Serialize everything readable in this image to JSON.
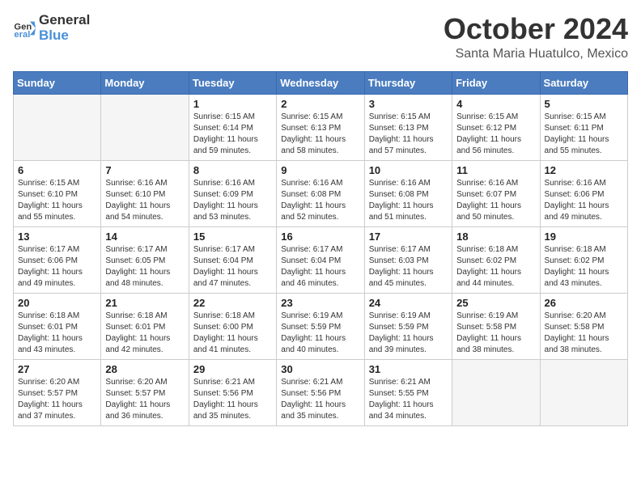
{
  "header": {
    "logo_general": "General",
    "logo_blue": "Blue",
    "month": "October 2024",
    "location": "Santa Maria Huatulco, Mexico"
  },
  "days_of_week": [
    "Sunday",
    "Monday",
    "Tuesday",
    "Wednesday",
    "Thursday",
    "Friday",
    "Saturday"
  ],
  "weeks": [
    [
      {
        "day": "",
        "info": ""
      },
      {
        "day": "",
        "info": ""
      },
      {
        "day": "1",
        "info": "Sunrise: 6:15 AM\nSunset: 6:14 PM\nDaylight: 11 hours and 59 minutes."
      },
      {
        "day": "2",
        "info": "Sunrise: 6:15 AM\nSunset: 6:13 PM\nDaylight: 11 hours and 58 minutes."
      },
      {
        "day": "3",
        "info": "Sunrise: 6:15 AM\nSunset: 6:13 PM\nDaylight: 11 hours and 57 minutes."
      },
      {
        "day": "4",
        "info": "Sunrise: 6:15 AM\nSunset: 6:12 PM\nDaylight: 11 hours and 56 minutes."
      },
      {
        "day": "5",
        "info": "Sunrise: 6:15 AM\nSunset: 6:11 PM\nDaylight: 11 hours and 55 minutes."
      }
    ],
    [
      {
        "day": "6",
        "info": "Sunrise: 6:15 AM\nSunset: 6:10 PM\nDaylight: 11 hours and 55 minutes."
      },
      {
        "day": "7",
        "info": "Sunrise: 6:16 AM\nSunset: 6:10 PM\nDaylight: 11 hours and 54 minutes."
      },
      {
        "day": "8",
        "info": "Sunrise: 6:16 AM\nSunset: 6:09 PM\nDaylight: 11 hours and 53 minutes."
      },
      {
        "day": "9",
        "info": "Sunrise: 6:16 AM\nSunset: 6:08 PM\nDaylight: 11 hours and 52 minutes."
      },
      {
        "day": "10",
        "info": "Sunrise: 6:16 AM\nSunset: 6:08 PM\nDaylight: 11 hours and 51 minutes."
      },
      {
        "day": "11",
        "info": "Sunrise: 6:16 AM\nSunset: 6:07 PM\nDaylight: 11 hours and 50 minutes."
      },
      {
        "day": "12",
        "info": "Sunrise: 6:16 AM\nSunset: 6:06 PM\nDaylight: 11 hours and 49 minutes."
      }
    ],
    [
      {
        "day": "13",
        "info": "Sunrise: 6:17 AM\nSunset: 6:06 PM\nDaylight: 11 hours and 49 minutes."
      },
      {
        "day": "14",
        "info": "Sunrise: 6:17 AM\nSunset: 6:05 PM\nDaylight: 11 hours and 48 minutes."
      },
      {
        "day": "15",
        "info": "Sunrise: 6:17 AM\nSunset: 6:04 PM\nDaylight: 11 hours and 47 minutes."
      },
      {
        "day": "16",
        "info": "Sunrise: 6:17 AM\nSunset: 6:04 PM\nDaylight: 11 hours and 46 minutes."
      },
      {
        "day": "17",
        "info": "Sunrise: 6:17 AM\nSunset: 6:03 PM\nDaylight: 11 hours and 45 minutes."
      },
      {
        "day": "18",
        "info": "Sunrise: 6:18 AM\nSunset: 6:02 PM\nDaylight: 11 hours and 44 minutes."
      },
      {
        "day": "19",
        "info": "Sunrise: 6:18 AM\nSunset: 6:02 PM\nDaylight: 11 hours and 43 minutes."
      }
    ],
    [
      {
        "day": "20",
        "info": "Sunrise: 6:18 AM\nSunset: 6:01 PM\nDaylight: 11 hours and 43 minutes."
      },
      {
        "day": "21",
        "info": "Sunrise: 6:18 AM\nSunset: 6:01 PM\nDaylight: 11 hours and 42 minutes."
      },
      {
        "day": "22",
        "info": "Sunrise: 6:18 AM\nSunset: 6:00 PM\nDaylight: 11 hours and 41 minutes."
      },
      {
        "day": "23",
        "info": "Sunrise: 6:19 AM\nSunset: 5:59 PM\nDaylight: 11 hours and 40 minutes."
      },
      {
        "day": "24",
        "info": "Sunrise: 6:19 AM\nSunset: 5:59 PM\nDaylight: 11 hours and 39 minutes."
      },
      {
        "day": "25",
        "info": "Sunrise: 6:19 AM\nSunset: 5:58 PM\nDaylight: 11 hours and 38 minutes."
      },
      {
        "day": "26",
        "info": "Sunrise: 6:20 AM\nSunset: 5:58 PM\nDaylight: 11 hours and 38 minutes."
      }
    ],
    [
      {
        "day": "27",
        "info": "Sunrise: 6:20 AM\nSunset: 5:57 PM\nDaylight: 11 hours and 37 minutes."
      },
      {
        "day": "28",
        "info": "Sunrise: 6:20 AM\nSunset: 5:57 PM\nDaylight: 11 hours and 36 minutes."
      },
      {
        "day": "29",
        "info": "Sunrise: 6:21 AM\nSunset: 5:56 PM\nDaylight: 11 hours and 35 minutes."
      },
      {
        "day": "30",
        "info": "Sunrise: 6:21 AM\nSunset: 5:56 PM\nDaylight: 11 hours and 35 minutes."
      },
      {
        "day": "31",
        "info": "Sunrise: 6:21 AM\nSunset: 5:55 PM\nDaylight: 11 hours and 34 minutes."
      },
      {
        "day": "",
        "info": ""
      },
      {
        "day": "",
        "info": ""
      }
    ]
  ]
}
